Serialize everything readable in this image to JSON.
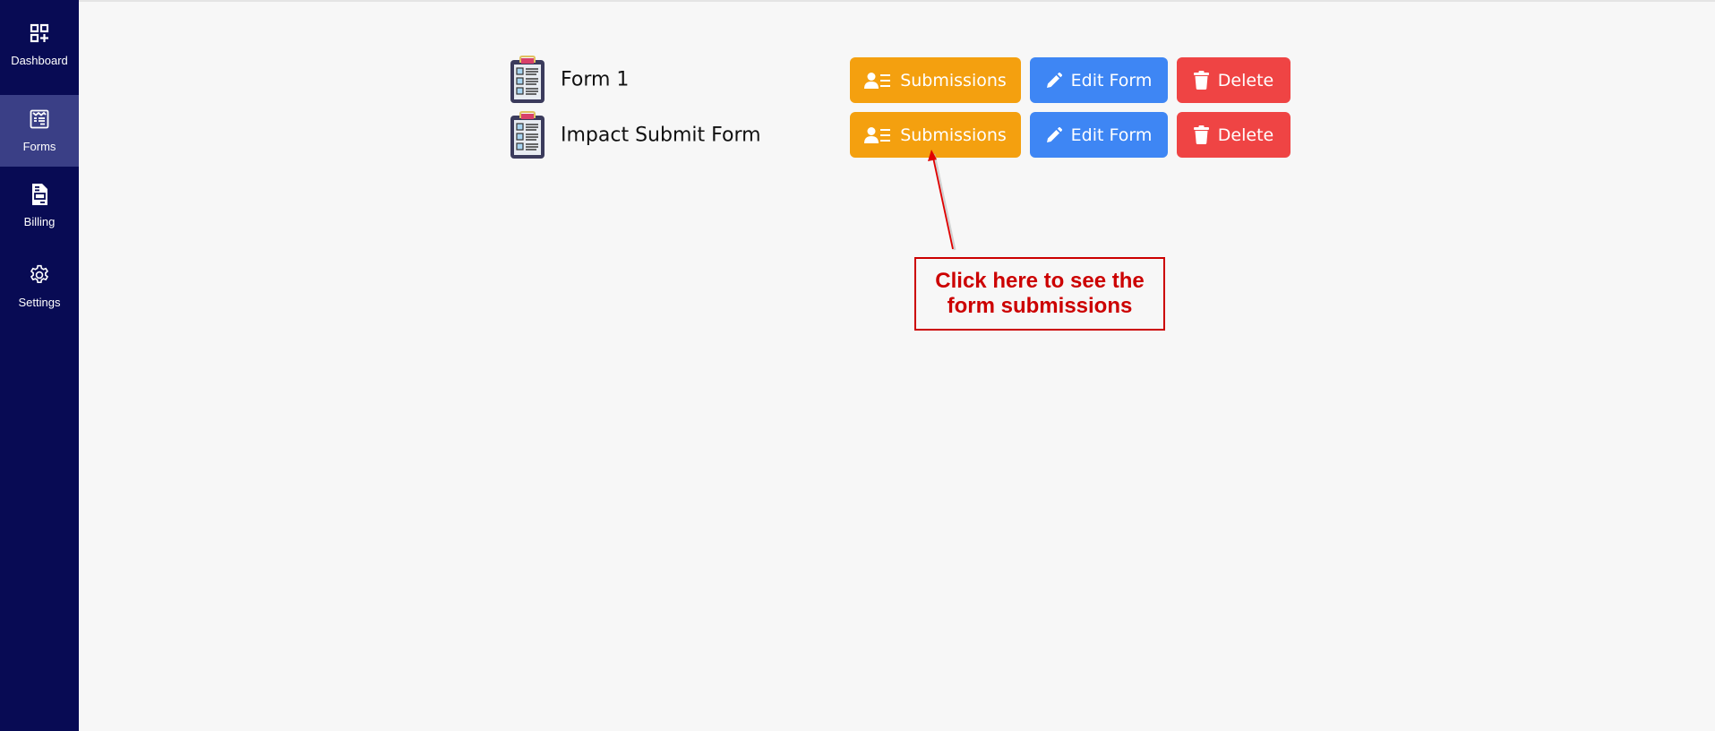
{
  "sidebar": {
    "items": [
      {
        "label": "Dashboard",
        "icon": "dashboard-icon",
        "active": false
      },
      {
        "label": "Forms",
        "icon": "forms-icon",
        "active": true
      },
      {
        "label": "Billing",
        "icon": "billing-icon",
        "active": false
      },
      {
        "label": "Settings",
        "icon": "gear-icon",
        "active": false
      }
    ]
  },
  "forms": [
    {
      "name": "Form 1",
      "icon": "clipboard-checklist-icon",
      "buttons": {
        "submissions": "Submissions",
        "edit": "Edit Form",
        "delete": "Delete"
      }
    },
    {
      "name": "Impact Submit Form",
      "icon": "clipboard-checklist-icon",
      "buttons": {
        "submissions": "Submissions",
        "edit": "Edit Form",
        "delete": "Delete"
      }
    }
  ],
  "colors": {
    "sidebar_bg": "#080b54",
    "sidebar_active": "#3a3f86",
    "submissions": "#f4a00f",
    "edit": "#3e86f4",
    "delete": "#ef4444",
    "annotation": "#cc0000"
  },
  "annotation": {
    "text_line1": "Click here to see the",
    "text_line2": "form submissions"
  }
}
